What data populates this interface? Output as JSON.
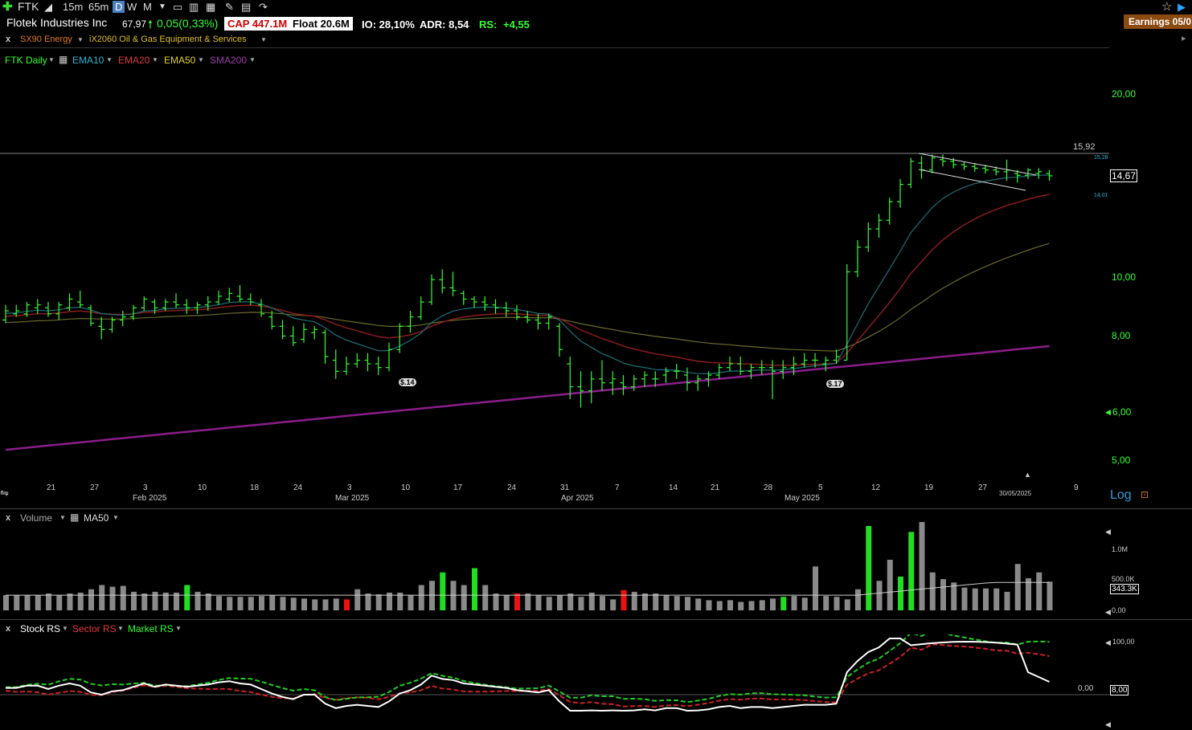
{
  "toolbar": {
    "ticker": "FTK",
    "timeframes": [
      "15m",
      "65m",
      "D",
      "W",
      "M"
    ],
    "active_timeframe": "D"
  },
  "info": {
    "company": "Flotek Industries Inc",
    "price": "67,97",
    "change": "0,05(0,33%)",
    "cap": "CAP 447.1M",
    "float": "Float 20.6M",
    "io": "IO: 28,10%",
    "adr": "ADR: 8,54",
    "rs_label": "RS:",
    "rs_value": "+4,55",
    "earnings": "Earnings 05/0"
  },
  "sector": {
    "x": "x",
    "sector": "SX90 Energy",
    "industry": "iX2060 Oil & Gas Equipment & Services"
  },
  "legend": {
    "main": "FTK Daily",
    "ema10": "EMA10",
    "ema20": "EMA20",
    "ema50": "EMA50",
    "sma200": "SMA200"
  },
  "price_axis": [
    "20,00",
    "10,00",
    "8,00",
    "6,00",
    "5,00"
  ],
  "price_markers": {
    "resistance": "15,92",
    "last": "14,67",
    "upper_small": "15,28",
    "lower_small": "14,01"
  },
  "event_labels": [
    "$.14",
    "$.17"
  ],
  "date_axis": {
    "days": [
      "21",
      "27",
      "3",
      "10",
      "18",
      "24",
      "3",
      "10",
      "17",
      "24",
      "31",
      "7",
      "14",
      "21",
      "28",
      "5",
      "12",
      "19",
      "27",
      "9"
    ],
    "months": [
      "Feb 2025",
      "Mar 2025",
      "Apr 2025",
      "May 2025"
    ],
    "cursor_date": "30/05/2025"
  },
  "log_label": "Log",
  "volume_pane": {
    "x": "x",
    "title": "Volume",
    "ma": "MA50",
    "axis": [
      "1.0M",
      "500.0K",
      "0,00"
    ],
    "last": "343.3K"
  },
  "rs_pane": {
    "x": "x",
    "stock": "Stock RS",
    "sector": "Sector RS",
    "market": "Market RS",
    "axis": [
      "100,00",
      "0,00"
    ],
    "last": "8,00"
  },
  "colors": {
    "up": "#33ff33",
    "ema10": "#1f6f7a",
    "ema20": "#8a1c1c",
    "ema50": "#6a6a2a",
    "sma200": "#8b1d8b",
    "vol_gray": "#8a8a8a",
    "vol_green": "#22dd22",
    "vol_red": "#ee1111"
  },
  "chart_data": {
    "type": "bar",
    "scale": "log",
    "ylim": [
      4.6,
      22
    ],
    "ohlc": [
      [
        8.5,
        9.0,
        8.4,
        8.8
      ],
      [
        8.7,
        9.0,
        8.6,
        8.8
      ],
      [
        8.7,
        9.1,
        8.6,
        9.0
      ],
      [
        8.9,
        9.2,
        8.7,
        9.0
      ],
      [
        8.9,
        9.1,
        8.6,
        8.7
      ],
      [
        8.7,
        9.1,
        8.5,
        9.0
      ],
      [
        8.9,
        9.4,
        8.8,
        9.2
      ],
      [
        9.1,
        9.5,
        8.9,
        9.0
      ],
      [
        8.9,
        9.0,
        8.3,
        8.4
      ],
      [
        8.3,
        8.6,
        7.9,
        8.2
      ],
      [
        8.2,
        8.6,
        8.1,
        8.5
      ],
      [
        8.5,
        8.8,
        8.3,
        8.6
      ],
      [
        8.6,
        9.0,
        8.5,
        8.9
      ],
      [
        8.9,
        9.3,
        8.8,
        9.2
      ],
      [
        9.1,
        9.2,
        8.7,
        8.9
      ],
      [
        8.9,
        9.2,
        8.8,
        9.1
      ],
      [
        9.1,
        9.4,
        8.9,
        9.0
      ],
      [
        9.0,
        9.2,
        8.7,
        8.9
      ],
      [
        8.9,
        9.1,
        8.7,
        9.0
      ],
      [
        9.0,
        9.3,
        8.8,
        9.1
      ],
      [
        9.1,
        9.5,
        9.0,
        9.3
      ],
      [
        9.2,
        9.6,
        9.1,
        9.4
      ],
      [
        9.3,
        9.7,
        9.1,
        9.2
      ],
      [
        9.2,
        9.4,
        9.0,
        9.1
      ],
      [
        9.0,
        9.2,
        8.6,
        8.7
      ],
      [
        8.6,
        8.8,
        8.2,
        8.3
      ],
      [
        8.3,
        8.5,
        7.9,
        8.0
      ],
      [
        8.0,
        8.3,
        7.7,
        7.8
      ],
      [
        7.9,
        8.4,
        7.8,
        8.2
      ],
      [
        8.1,
        8.3,
        7.9,
        8.2
      ],
      [
        8.1,
        8.2,
        7.2,
        7.4
      ],
      [
        7.3,
        7.6,
        6.8,
        7.0
      ],
      [
        7.0,
        7.4,
        6.9,
        7.2
      ],
      [
        7.2,
        7.5,
        7.1,
        7.3
      ],
      [
        7.3,
        7.5,
        7.0,
        7.2
      ],
      [
        7.2,
        7.4,
        6.9,
        7.1
      ],
      [
        7.1,
        7.8,
        7.0,
        7.6
      ],
      [
        7.6,
        8.4,
        7.5,
        8.3
      ],
      [
        8.3,
        8.8,
        8.1,
        8.6
      ],
      [
        8.6,
        9.3,
        8.5,
        9.1
      ],
      [
        9.1,
        10.1,
        9.0,
        9.9
      ],
      [
        9.9,
        10.3,
        9.4,
        9.6
      ],
      [
        9.6,
        10.2,
        9.3,
        9.5
      ],
      [
        9.4,
        9.5,
        9.0,
        9.2
      ],
      [
        9.2,
        9.3,
        8.9,
        9.1
      ],
      [
        9.1,
        9.3,
        8.8,
        9.0
      ],
      [
        9.0,
        9.2,
        8.7,
        8.9
      ],
      [
        8.9,
        9.1,
        8.6,
        8.8
      ],
      [
        8.8,
        9.0,
        8.5,
        8.6
      ],
      [
        8.6,
        8.8,
        8.4,
        8.5
      ],
      [
        8.5,
        8.7,
        8.2,
        8.4
      ],
      [
        8.4,
        8.7,
        8.2,
        8.6
      ],
      [
        8.3,
        8.4,
        7.4,
        7.6
      ],
      [
        7.2,
        7.4,
        6.3,
        6.6
      ],
      [
        6.6,
        7.0,
        6.1,
        6.5
      ],
      [
        6.5,
        7.0,
        6.2,
        6.8
      ],
      [
        6.8,
        7.3,
        6.5,
        6.7
      ],
      [
        6.7,
        7.0,
        6.4,
        6.8
      ],
      [
        6.7,
        6.9,
        6.4,
        6.6
      ],
      [
        6.6,
        6.9,
        6.5,
        6.8
      ],
      [
        6.8,
        7.0,
        6.6,
        6.9
      ],
      [
        6.8,
        7.0,
        6.6,
        6.8
      ],
      [
        6.9,
        7.1,
        6.7,
        7.0
      ],
      [
        7.0,
        7.2,
        6.8,
        7.0
      ],
      [
        6.9,
        7.1,
        6.5,
        6.7
      ],
      [
        6.7,
        6.9,
        6.5,
        6.8
      ],
      [
        6.8,
        7.0,
        6.6,
        6.9
      ],
      [
        6.9,
        7.2,
        6.8,
        7.1
      ],
      [
        7.1,
        7.4,
        7.0,
        7.2
      ],
      [
        7.2,
        7.4,
        6.9,
        7.0
      ],
      [
        7.0,
        7.2,
        6.8,
        7.1
      ],
      [
        7.1,
        7.3,
        6.9,
        7.1
      ],
      [
        7.1,
        7.3,
        6.3,
        7.0
      ],
      [
        7.0,
        7.3,
        6.8,
        7.1
      ],
      [
        7.1,
        7.4,
        6.9,
        7.2
      ],
      [
        7.2,
        7.5,
        7.1,
        7.3
      ],
      [
        7.3,
        7.5,
        7.1,
        7.3
      ],
      [
        7.2,
        7.4,
        7.0,
        7.3
      ],
      [
        7.3,
        7.6,
        7.2,
        7.4
      ],
      [
        7.3,
        10.5,
        7.3,
        10.2
      ],
      [
        10.2,
        11.5,
        10.0,
        11.2
      ],
      [
        11.2,
        12.3,
        11.0,
        12.0
      ],
      [
        12.0,
        12.7,
        11.6,
        12.4
      ],
      [
        12.4,
        13.5,
        12.2,
        13.3
      ],
      [
        13.3,
        14.5,
        13.0,
        14.2
      ],
      [
        14.2,
        15.7,
        14.0,
        15.5
      ],
      [
        15.4,
        15.8,
        14.5,
        15.0
      ],
      [
        15.0,
        15.9,
        14.8,
        15.7
      ],
      [
        15.6,
        15.9,
        15.2,
        15.5
      ],
      [
        15.5,
        15.7,
        15.1,
        15.3
      ],
      [
        15.3,
        15.5,
        15.0,
        15.2
      ],
      [
        15.2,
        15.4,
        14.9,
        15.1
      ],
      [
        15.1,
        15.3,
        14.8,
        15.0
      ],
      [
        15.0,
        15.2,
        14.7,
        14.9
      ],
      [
        14.9,
        15.6,
        14.4,
        15.0
      ],
      [
        14.8,
        15.0,
        14.3,
        14.7
      ],
      [
        14.7,
        15.1,
        14.5,
        15.0
      ],
      [
        14.8,
        15.1,
        14.5,
        14.9
      ],
      [
        14.8,
        15.0,
        14.4,
        14.67
      ]
    ],
    "volume": [
      [
        0.18,
        "g"
      ],
      [
        0.18,
        "g"
      ],
      [
        0.18,
        "g"
      ],
      [
        0.18,
        "g"
      ],
      [
        0.2,
        "g"
      ],
      [
        0.18,
        "g"
      ],
      [
        0.2,
        "g"
      ],
      [
        0.21,
        "g"
      ],
      [
        0.25,
        "g"
      ],
      [
        0.3,
        "g"
      ],
      [
        0.28,
        "g"
      ],
      [
        0.29,
        "g"
      ],
      [
        0.22,
        "g"
      ],
      [
        0.2,
        "g"
      ],
      [
        0.22,
        "g"
      ],
      [
        0.21,
        "g"
      ],
      [
        0.21,
        "g"
      ],
      [
        0.3,
        "G"
      ],
      [
        0.22,
        "g"
      ],
      [
        0.2,
        "g"
      ],
      [
        0.17,
        "g"
      ],
      [
        0.16,
        "g"
      ],
      [
        0.16,
        "g"
      ],
      [
        0.16,
        "g"
      ],
      [
        0.17,
        "g"
      ],
      [
        0.18,
        "g"
      ],
      [
        0.16,
        "g"
      ],
      [
        0.15,
        "g"
      ],
      [
        0.14,
        "g"
      ],
      [
        0.13,
        "g"
      ],
      [
        0.13,
        "g"
      ],
      [
        0.14,
        "g"
      ],
      [
        0.13,
        "R"
      ],
      [
        0.25,
        "g"
      ],
      [
        0.2,
        "g"
      ],
      [
        0.19,
        "g"
      ],
      [
        0.21,
        "g"
      ],
      [
        0.21,
        "g"
      ],
      [
        0.18,
        "g"
      ],
      [
        0.3,
        "g"
      ],
      [
        0.35,
        "g"
      ],
      [
        0.45,
        "G"
      ],
      [
        0.35,
        "g"
      ],
      [
        0.3,
        "g"
      ],
      [
        0.5,
        "G"
      ],
      [
        0.3,
        "g"
      ],
      [
        0.2,
        "g"
      ],
      [
        0.18,
        "g"
      ],
      [
        0.2,
        "R"
      ],
      [
        0.2,
        "g"
      ],
      [
        0.18,
        "g"
      ],
      [
        0.16,
        "g"
      ],
      [
        0.18,
        "g"
      ],
      [
        0.2,
        "g"
      ],
      [
        0.16,
        "g"
      ],
      [
        0.21,
        "g"
      ],
      [
        0.17,
        "g"
      ],
      [
        0.13,
        "g"
      ],
      [
        0.24,
        "R"
      ],
      [
        0.22,
        "g"
      ],
      [
        0.2,
        "g"
      ],
      [
        0.2,
        "g"
      ],
      [
        0.18,
        "g"
      ],
      [
        0.17,
        "g"
      ],
      [
        0.16,
        "g"
      ],
      [
        0.14,
        "g"
      ],
      [
        0.12,
        "g"
      ],
      [
        0.11,
        "g"
      ],
      [
        0.12,
        "g"
      ],
      [
        0.1,
        "g"
      ],
      [
        0.11,
        "g"
      ],
      [
        0.12,
        "g"
      ],
      [
        0.14,
        "g"
      ],
      [
        0.16,
        "G"
      ],
      [
        0.17,
        "g"
      ],
      [
        0.15,
        "g"
      ],
      [
        0.52,
        "g"
      ],
      [
        0.17,
        "g"
      ],
      [
        0.16,
        "g"
      ],
      [
        0.13,
        "g"
      ],
      [
        0.25,
        "g"
      ],
      [
        1.0,
        "G"
      ],
      [
        0.35,
        "g"
      ],
      [
        0.6,
        "g"
      ],
      [
        0.4,
        "G"
      ],
      [
        0.93,
        "G"
      ],
      [
        1.05,
        "g"
      ],
      [
        0.45,
        "g"
      ],
      [
        0.37,
        "g"
      ],
      [
        0.33,
        "g"
      ],
      [
        0.27,
        "g"
      ],
      [
        0.26,
        "g"
      ],
      [
        0.26,
        "g"
      ],
      [
        0.26,
        "g"
      ],
      [
        0.22,
        "g"
      ],
      [
        0.55,
        "g"
      ],
      [
        0.38,
        "g"
      ],
      [
        0.45,
        "g"
      ],
      [
        0.34,
        "g"
      ]
    ]
  }
}
